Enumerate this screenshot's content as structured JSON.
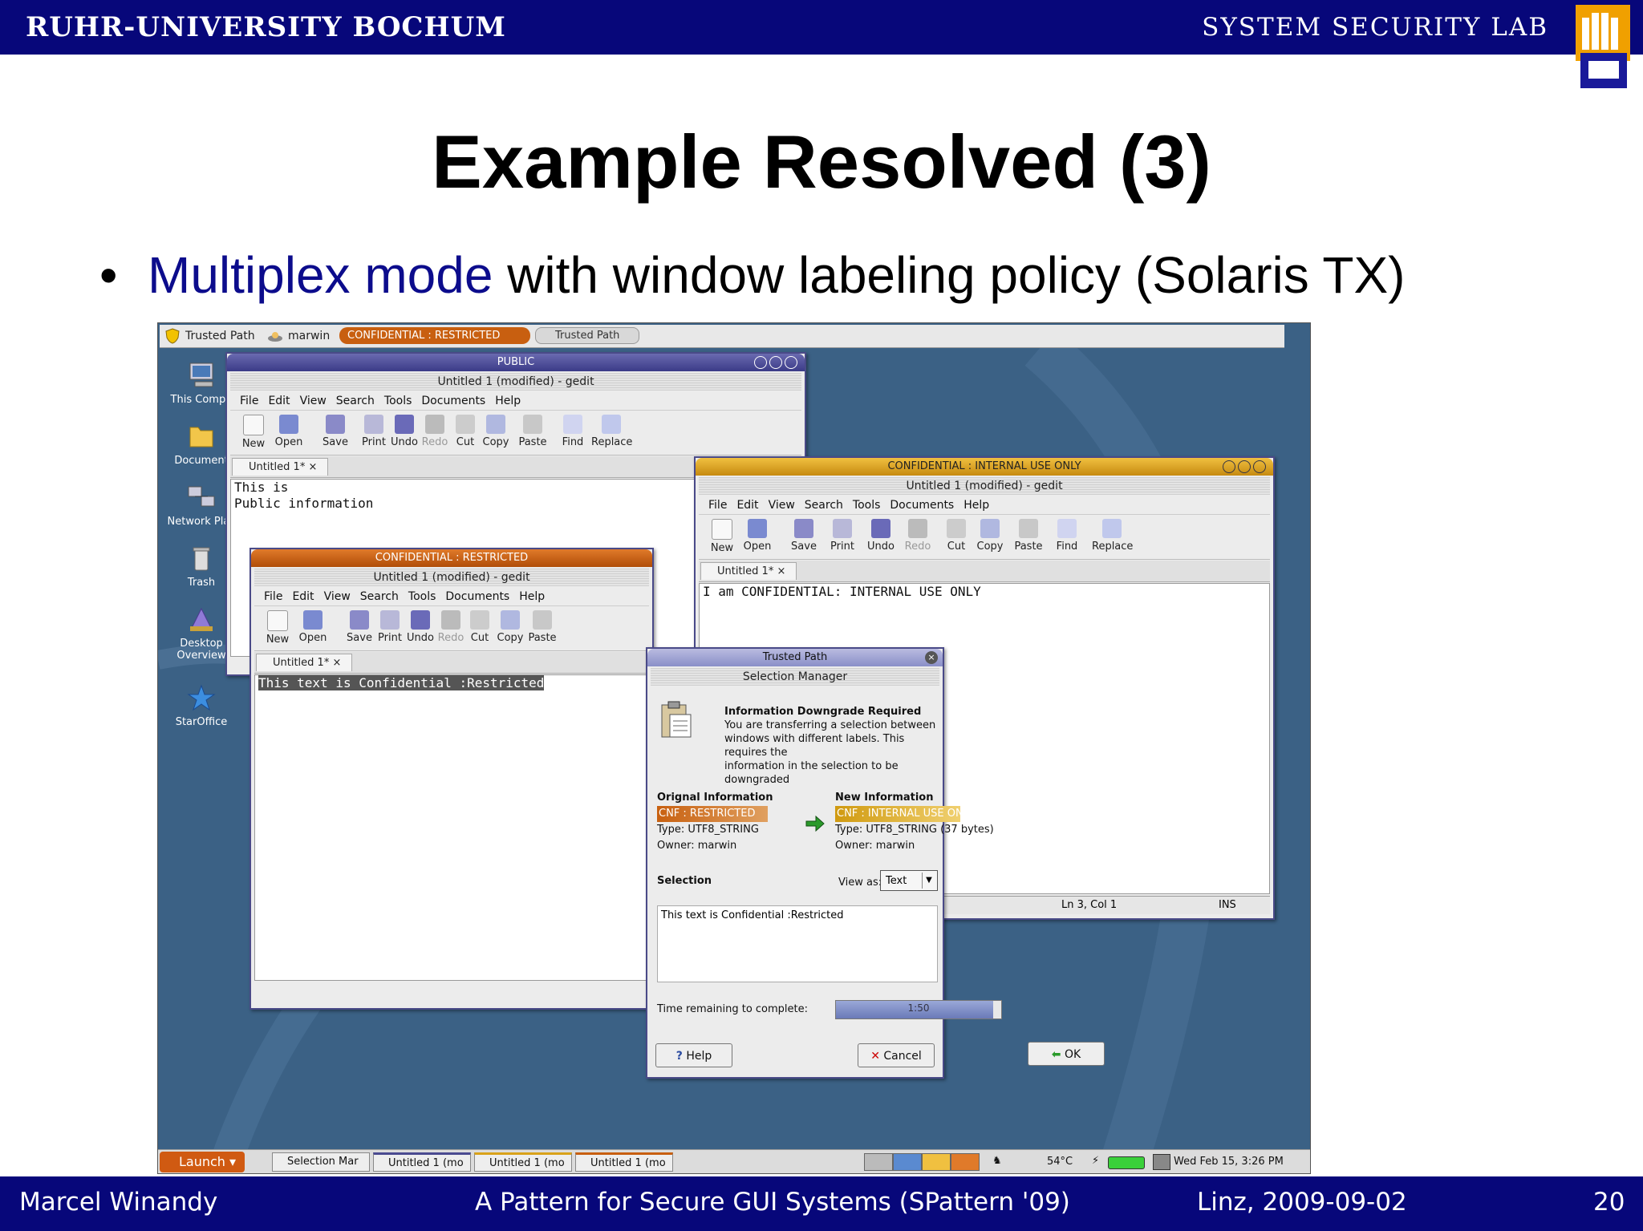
{
  "header": {
    "university": "RUHR-UNIVERSITY BOCHUM",
    "lab": "SYSTEM SECURITY LAB"
  },
  "slide": {
    "title": "Example Resolved (3)",
    "bullet_highlight": "Multiplex mode",
    "bullet_rest": " with window labeling policy (Solaris TX)"
  },
  "footer": {
    "author": "Marcel Winandy",
    "talk": "A Pattern for Secure GUI Systems (SPattern '09)",
    "place_date": "Linz, 2009-09-02",
    "page": "20"
  },
  "colors": {
    "header_blue": "#07077a",
    "confidential_restricted": "#c85f10",
    "confidential_internal": "#d9a21a",
    "public": "#4a4a90"
  },
  "trusted_path_bar": {
    "label": "Trusted Path",
    "user": "marwin",
    "current_label": "CONFIDENTIAL : RESTRICTED",
    "button": "Trusted Path"
  },
  "desktop_icons": [
    "This Compu",
    "Document",
    "Network Plac",
    "Trash",
    "Desktop Overview",
    "StarOffice"
  ],
  "gedit": {
    "menus": [
      "File",
      "Edit",
      "View",
      "Search",
      "Tools",
      "Documents",
      "Help"
    ],
    "tools": [
      "New",
      "Open",
      "Save",
      "Print",
      "Undo",
      "Redo",
      "Cut",
      "Copy",
      "Paste",
      "Find",
      "Replace"
    ],
    "tab": "Untitled 1*"
  },
  "win_public": {
    "label": "PUBLIC",
    "title": "Untitled 1 (modified) - gedit",
    "lines": [
      "This is",
      "Public information"
    ]
  },
  "win_restricted": {
    "label": "CONFIDENTIAL : RESTRICTED",
    "title": "Untitled 1 (modified) - gedit",
    "text": "This text is Confidential :Restricted"
  },
  "win_internal": {
    "label": "CONFIDENTIAL : INTERNAL USE ONLY",
    "title": "Untitled 1 (modified) - gedit",
    "text": "I am CONFIDENTIAL: INTERNAL USE ONLY",
    "status_pos": "Ln 3, Col 1",
    "status_mode": "INS"
  },
  "dialog": {
    "titlebar": "Trusted Path",
    "subtitle": "Selection Manager",
    "heading": "Information Downgrade Required",
    "message": [
      "You are transferring a selection between",
      "windows with different labels.  This requires the",
      "information in the selection to be downgraded"
    ],
    "orig_heading": "Orignal Information",
    "orig_label": "CNF : RESTRICTED",
    "orig_type": "Type: UTF8_STRING",
    "orig_owner": "Owner:   marwin",
    "new_heading": "New Information",
    "new_label": "CNF : INTERNAL USE ONLY",
    "new_type": "Type: UTF8_STRING (37 bytes)",
    "new_owner": "Owner:   marwin",
    "selection_label": "Selection",
    "view_as_label": "View as:",
    "view_as_value": "Text",
    "selection_text": "This text is Confidential :Restricted",
    "time_label": "Time remaining to complete:",
    "time_value": "1:50",
    "time_progress": 0.95,
    "help": "Help",
    "cancel": "Cancel",
    "ok": "OK"
  },
  "taskbar": {
    "launch": "Launch",
    "tasks": [
      "Selection Mar",
      "Untitled 1 (mo",
      "Untitled 1 (mo",
      "Untitled 1 (mo"
    ],
    "temp": "54°C",
    "clock": "Wed Feb 15,  3:26 PM"
  }
}
